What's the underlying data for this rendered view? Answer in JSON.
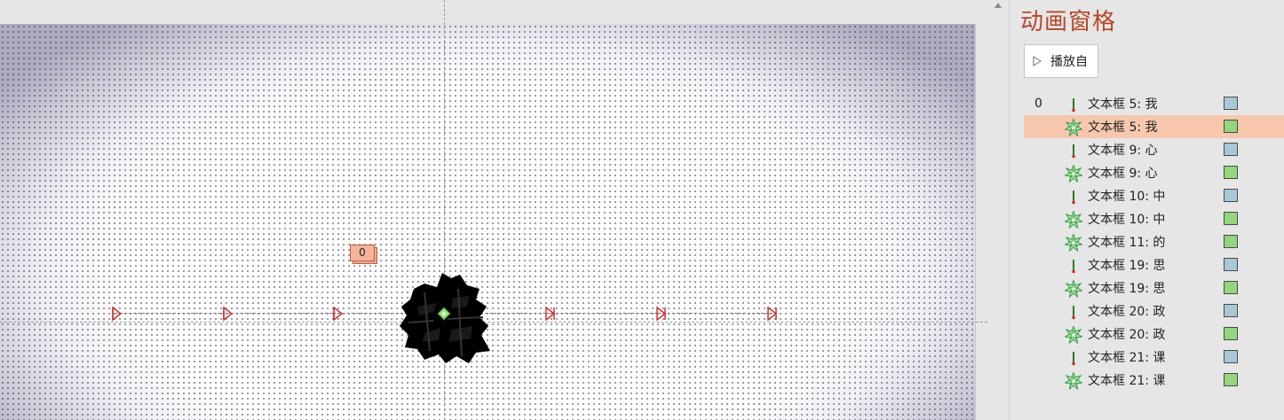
{
  "pane": {
    "title": "动画窗格",
    "play_button_label": "播放自"
  },
  "slide": {
    "animation_tag": "0"
  },
  "colors": {
    "entrance_bar": "#a9c7d6",
    "emphasis_bar": "#93d67b",
    "selected_row": "#f7c8ad",
    "title": "#b7472a"
  },
  "animations": [
    {
      "num": "0",
      "icon": "line-path-icon",
      "label": "文本框 5: 我",
      "bar": "entrance",
      "selected": false
    },
    {
      "num": "",
      "icon": "star-burst-icon",
      "label": "文本框 5: 我",
      "bar": "emphasis",
      "selected": true
    },
    {
      "num": "",
      "icon": "line-path-icon",
      "label": "文本框 9: 心",
      "bar": "entrance",
      "selected": false
    },
    {
      "num": "",
      "icon": "star-burst-icon",
      "label": "文本框 9: 心",
      "bar": "emphasis",
      "selected": false
    },
    {
      "num": "",
      "icon": "line-path-icon",
      "label": "文本框 10: 中",
      "bar": "entrance",
      "selected": false
    },
    {
      "num": "",
      "icon": "star-burst-icon",
      "label": "文本框 10: 中",
      "bar": "emphasis",
      "selected": false
    },
    {
      "num": "",
      "icon": "star-burst-icon",
      "label": "文本框 11: 的",
      "bar": "emphasis",
      "selected": false
    },
    {
      "num": "",
      "icon": "line-path-icon",
      "label": "文本框 19: 思",
      "bar": "entrance",
      "selected": false
    },
    {
      "num": "",
      "icon": "star-burst-icon",
      "label": "文本框 19: 思",
      "bar": "emphasis",
      "selected": false
    },
    {
      "num": "",
      "icon": "line-path-icon",
      "label": "文本框 20: 政",
      "bar": "entrance",
      "selected": false
    },
    {
      "num": "",
      "icon": "star-burst-icon",
      "label": "文本框 20: 政",
      "bar": "emphasis",
      "selected": false
    },
    {
      "num": "",
      "icon": "line-path-icon",
      "label": "文本框 21: 课",
      "bar": "entrance",
      "selected": false
    },
    {
      "num": "",
      "icon": "star-burst-icon",
      "label": "文本框 21: 课",
      "bar": "emphasis",
      "selected": false
    }
  ]
}
